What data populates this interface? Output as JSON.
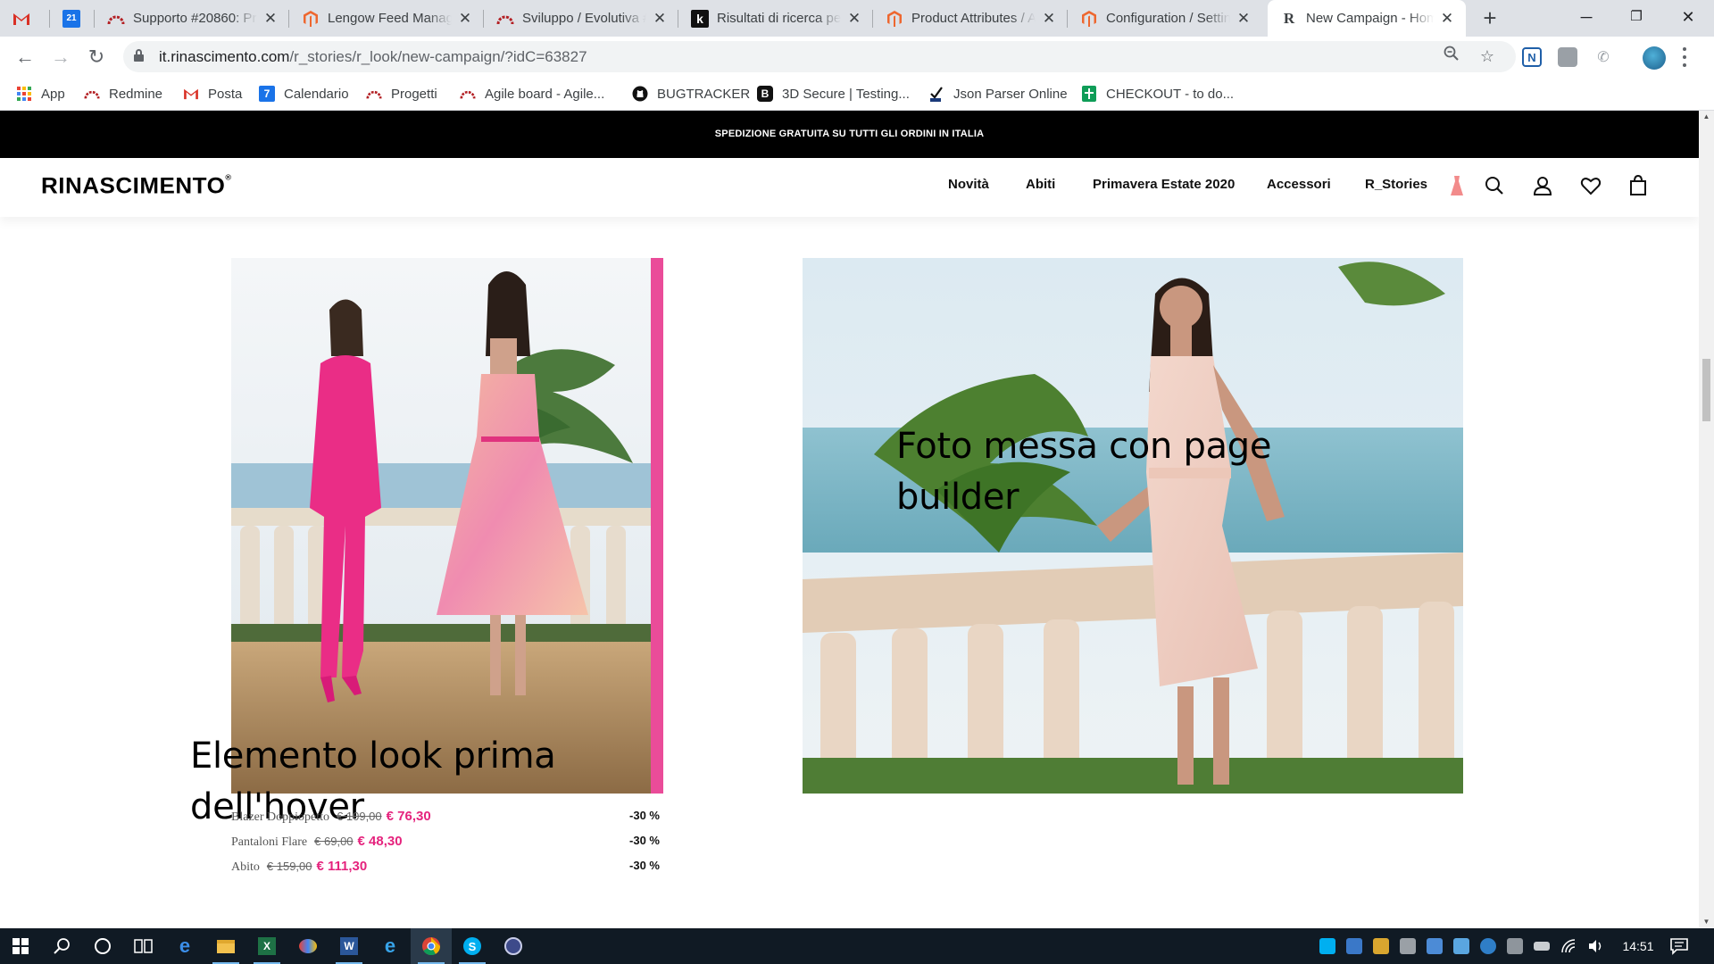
{
  "browser": {
    "tabs": [
      {
        "title": "",
        "favicon": "gmail-icon",
        "color": "#d93025"
      },
      {
        "title": "",
        "favicon": "calendar-icon",
        "color": "#1a73e8",
        "badge": "21"
      },
      {
        "title": "Supporto #20860: Pr",
        "favicon": "redmine-icon",
        "color": "#b32024"
      },
      {
        "title": "Lengow Feed Manag",
        "favicon": "magento-icon",
        "color": "#ee672f"
      },
      {
        "title": "Sviluppo / Evolutiva #",
        "favicon": "redmine-icon",
        "color": "#b32024"
      },
      {
        "title": "Risultati di ricerca pe",
        "favicon": "k-icon",
        "color": "#111111",
        "badge": "k"
      },
      {
        "title": "Product Attributes / A",
        "favicon": "magento-icon",
        "color": "#ee672f"
      },
      {
        "title": "Configuration / Settin",
        "favicon": "magento-icon",
        "color": "#ee672f"
      },
      {
        "title": "New Campaign - Hom",
        "favicon": "rinascimento-icon",
        "color": "#000000",
        "badge": "R",
        "active": true
      }
    ],
    "url_host": "it.rinascimento.com",
    "url_path": "/r_stories/r_look/new-campaign/?idC=63827",
    "bookmarks": [
      {
        "label": "App",
        "icon": "apps-grid-icon"
      },
      {
        "label": "Redmine",
        "icon": "redmine-icon"
      },
      {
        "label": "Posta",
        "icon": "gmail-icon"
      },
      {
        "label": "Calendario",
        "icon": "calendar-icon",
        "badge": "7"
      },
      {
        "label": "Progetti",
        "icon": "redmine-icon"
      },
      {
        "label": "Agile board - Agile...",
        "icon": "redmine-icon"
      },
      {
        "label": "BUGTRACKER",
        "icon": "github-icon"
      },
      {
        "label": "3D Secure | Testing...",
        "icon": "b-icon",
        "badge": "B"
      },
      {
        "label": "Json Parser Online",
        "icon": "json-icon"
      },
      {
        "label": "CHECKOUT - to do...",
        "icon": "sheets-icon"
      }
    ]
  },
  "site": {
    "promo": "SPEDIZIONE GRATUITA SU TUTTI GLI ORDINI IN ITALIA",
    "logo": "RINASCIMENTO",
    "logo_mark": "®",
    "menu": [
      "Novità",
      "Abiti",
      "Primavera Estate 2020",
      "Accessori",
      "R_Stories"
    ],
    "accent": "#e5237d",
    "annotations": {
      "look_before_hover": "Elemento look prima dell'hover",
      "page_builder_photo": "Foto messa con page builder"
    },
    "products": [
      {
        "name": "Blazer Doppiopetto",
        "old_price": "€ 109,00",
        "new_price": "€ 76,30",
        "discount": "-30 %"
      },
      {
        "name": "Pantaloni Flare",
        "old_price": "€ 69,00",
        "new_price": "€ 48,30",
        "discount": "-30 %"
      },
      {
        "name": "Abito",
        "old_price": "€ 159,00",
        "new_price": "€ 111,30",
        "discount": "-30 %"
      }
    ]
  },
  "taskbar": {
    "clock": "14:51"
  }
}
